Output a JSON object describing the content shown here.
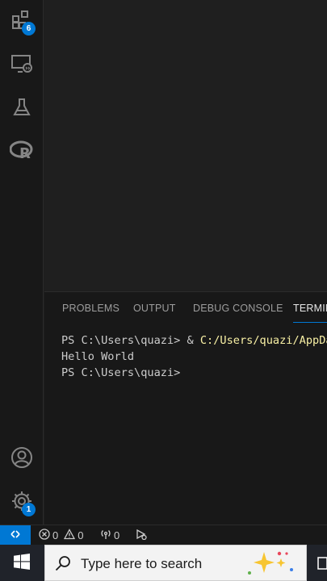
{
  "activity_bar": {
    "extensions_badge": "6",
    "settings_badge": "1"
  },
  "panel": {
    "tabs": [
      {
        "label": "PROBLEMS"
      },
      {
        "label": "OUTPUT"
      },
      {
        "label": "DEBUG CONSOLE"
      },
      {
        "label": "TERMINAL"
      }
    ],
    "terminal": {
      "line1_prompt": "PS C:\\Users\\quazi> & ",
      "line1_path": "C:/Users/quazi/AppData/Local/Programs/Python/python.exe",
      "line2": "Hello World",
      "line3": "PS C:\\Users\\quazi>"
    }
  },
  "statusbar": {
    "errors": "0",
    "warnings": "0",
    "ports": "0"
  },
  "taskbar": {
    "search_placeholder": "Type here to search"
  },
  "colors": {
    "accent": "#0078d4",
    "terminal_path": "#f9f1a5"
  }
}
